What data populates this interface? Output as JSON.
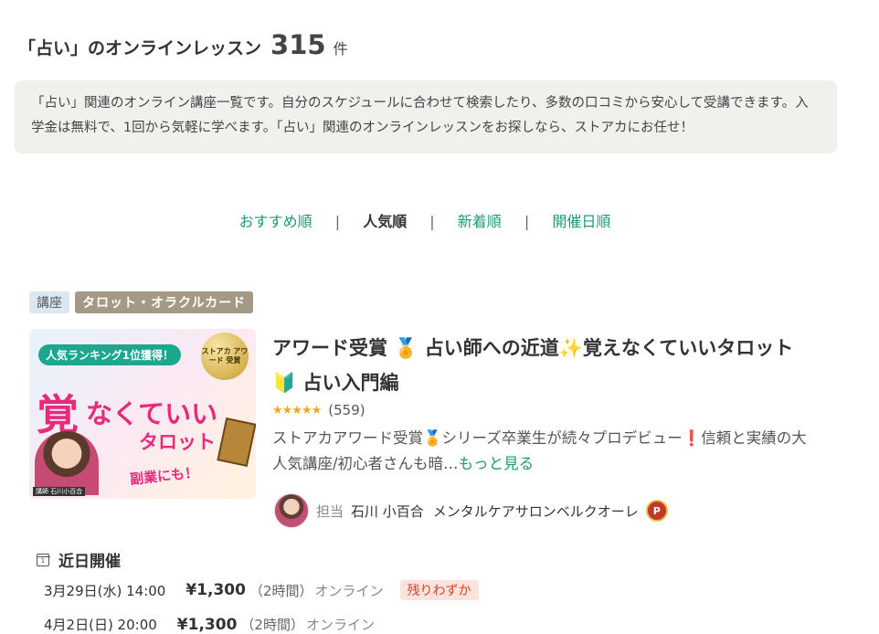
{
  "header": {
    "label": "「占い」のオンラインレッスン",
    "count": "315",
    "unit": "件"
  },
  "description": "「占い」関連のオンライン講座一覧です。自分のスケジュールに合わせて検索したり、多数の口コミから安心して受講できます。入学金は無料で、1回から気軽に学べます。「占い」関連のオンラインレッスンをお探しなら、ストアカにお任せ！",
  "sort": {
    "items": [
      "おすすめ順",
      "人気順",
      "新着順",
      "開催日順"
    ],
    "active": "人気順",
    "separator": "|"
  },
  "course": {
    "tags": [
      "講座",
      "タロット・オラクルカード"
    ],
    "thumbnail": {
      "ranking_badge": "人気ランキング1位獲得！",
      "medal": "ストアカ アワード 受賞",
      "headline_1": "覚",
      "headline_2": "なくていい",
      "headline_3": "タロット",
      "side_text": "副業にも！",
      "caption": "講師 石川小百合"
    },
    "title": "アワード受賞 🏅 占い師への近道✨覚えなくていいタロット 🔰 占い入門編",
    "rating_stars": "★★★★★",
    "rating_count": "(559)",
    "summary": "ストアカアワード受賞🏅シリーズ卒業生が続々プロデビュー❗信頼と実績の大人気講座/初心者さんも暗…",
    "more_label": "もっと見る",
    "instructor": {
      "role": "担当",
      "name": "石川 小百合",
      "salon": "メンタルケアサロンベルクオーレ",
      "badge": "P"
    },
    "upcoming_label": "近日開催",
    "calendar_day": "1",
    "sessions": [
      {
        "when": "3月29日(水) 14:00",
        "price": "¥1,300",
        "duration": "（2時間）",
        "mode": "オンライン",
        "status": "残りわずか"
      },
      {
        "when": "4月2日(日) 20:00",
        "price": "¥1,300",
        "duration": "（2時間）",
        "mode": "オンライン",
        "status": ""
      }
    ]
  },
  "colors": {
    "accent": "#1f9a76",
    "status_bg": "#fde3dc",
    "status_text": "#d0452c",
    "star": "#f2a52a",
    "tag_category_bg": "#a39985"
  }
}
